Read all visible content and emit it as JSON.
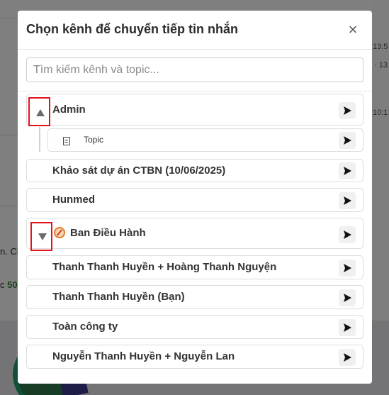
{
  "modal": {
    "title": "Chọn kênh để chuyển tiếp tin nhắn",
    "close_label": "×",
    "search_placeholder": "Tìm kiếm kênh và topic..."
  },
  "channels": [
    {
      "label": "Admin",
      "expanded": true,
      "toggle": "collapse",
      "send_icon": "send-icon"
    },
    {
      "label": "Topic",
      "type": "topic",
      "icon": "topic-icon",
      "send_icon": "send-icon"
    },
    {
      "label": "Khảo sát dự án CTBN (10/06/2025)",
      "send_icon": "send-icon"
    },
    {
      "label": "Hunmed",
      "send_icon": "send-icon"
    },
    {
      "label": "Ban Điều Hành",
      "expanded": false,
      "toggle": "expand",
      "icon": "compass-icon",
      "send_icon": "send-icon"
    },
    {
      "label": "Thanh Thanh Huyền + Hoàng Thanh Nguyện",
      "send_icon": "send-icon"
    },
    {
      "label": "Thanh Thanh Huyền (Bạn)",
      "send_icon": "send-icon"
    },
    {
      "label": "Toàn công ty",
      "send_icon": "send-icon"
    },
    {
      "label": "Nguyễn Thanh Huyền + Nguyễn Lan",
      "send_icon": "send-icon"
    }
  ],
  "background": {
    "times": [
      "13:5",
      "· 13",
      "10:1"
    ],
    "snippets": [
      "n. Ch",
      "c",
      "50"
    ]
  },
  "colors": {
    "highlight": "#e0141c",
    "overlay": "rgba(0,0,0,0.5)",
    "accent_green": "#2e8b2e"
  }
}
